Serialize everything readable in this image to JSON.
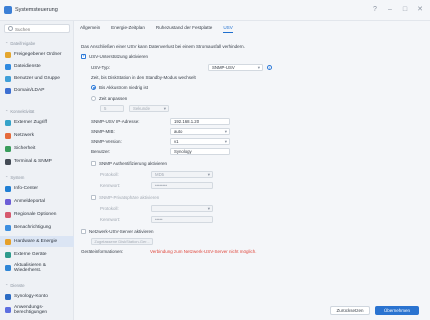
{
  "window": {
    "title": "Systemsteuerung"
  },
  "search": {
    "placeholder": "Suchen"
  },
  "sidebar": {
    "sections": [
      {
        "label": "Dateifreigabe"
      },
      {
        "label": "Konnektivität"
      },
      {
        "label": "System"
      },
      {
        "label": "Dienste"
      }
    ],
    "items": [
      {
        "label": "Freigegebener Ordner",
        "color": "#e4a62e"
      },
      {
        "label": "Dateidienste",
        "color": "#2f8ae0"
      },
      {
        "label": "Benutzer und Gruppe",
        "color": "#3f9fd8"
      },
      {
        "label": "Domain/LDAP",
        "color": "#3c6fd1"
      },
      {
        "label": "Externer Zugriff",
        "color": "#35a3c9"
      },
      {
        "label": "Netzwerk",
        "color": "#e56b3c"
      },
      {
        "label": "Sicherheit",
        "color": "#3a9d5c"
      },
      {
        "label": "Terminal & SNMP",
        "color": "#444b55"
      },
      {
        "label": "Info-Center",
        "color": "#1f7fd4"
      },
      {
        "label": "Anmeldeportal",
        "color": "#6c5ed6"
      },
      {
        "label": "Regionale Optionen",
        "color": "#d65a6f"
      },
      {
        "label": "Benachrichtigung",
        "color": "#3d8fe0"
      },
      {
        "label": "Hardware & Energie",
        "color": "#e6a02a"
      },
      {
        "label": "Externe Geräte",
        "color": "#2d9a8c"
      },
      {
        "label": "Aktualisieren & Wiederherst.",
        "color": "#2f86d6"
      },
      {
        "label": "Synology-Konto",
        "color": "#2b6cc4"
      },
      {
        "label": "Anwendungs-berechtigungen",
        "color": "#5d6fe0"
      }
    ]
  },
  "tabs": [
    {
      "label": "Allgemein"
    },
    {
      "label": "Energie-Zeitplan"
    },
    {
      "label": "Ruhezustand der Festplatte"
    },
    {
      "label": "USV"
    }
  ],
  "ups": {
    "intro": "Das Anschließen einer USV kann Datenverlust bei einem Stromausfall verhindern.",
    "enable_label": "USV-Unterstützung aktivieren",
    "type_label": "USV-Typ:",
    "type_value": "SNMP-USV",
    "standby_label": "Zeit, bis DiskStation in den Standby-Modus wechselt",
    "until_low_label": "Bis Akkustrom niedrig ist",
    "custom_label": "Zeit anpassen",
    "custom_value": "5",
    "custom_unit": "Sekunde",
    "ip_label": "SNMP-USV IP-Adresse:",
    "ip_value": "192.168.1.20",
    "mib_label": "SNMP-MIB:",
    "mib_value": "auto",
    "version_label": "SNMP-Version:",
    "version_value": "v1",
    "community_label": "Benutzer:",
    "community_value": "Synology",
    "auth_label": "SNMP Authentifizierung aktivieren",
    "auth_protocol_label": "Protokoll:",
    "auth_protocol_value": "MD5",
    "auth_password_label": "Kennwort:",
    "auth_password_value": "••••••••",
    "privacy_label": "SNMP-Privatsphäre aktivieren",
    "priv_protocol_label": "Protokoll:",
    "priv_protocol_value": "",
    "priv_password_label": "Kennwort:",
    "priv_password_value": "•••••",
    "network_server_label": "Netzwerk-USV-Server aktivieren",
    "permitted_button": "Zugelassene DiskStation-Ger...",
    "device_info_label": "Geräteinformationen:",
    "device_info_value": "Verbindung zum Netzwerk-USV-Server nicht möglich."
  },
  "footer": {
    "reset": "Zurücksetzen",
    "apply": "Übernehmen"
  },
  "colors": {
    "accent": "#2a73d0",
    "error": "#e0473d"
  }
}
